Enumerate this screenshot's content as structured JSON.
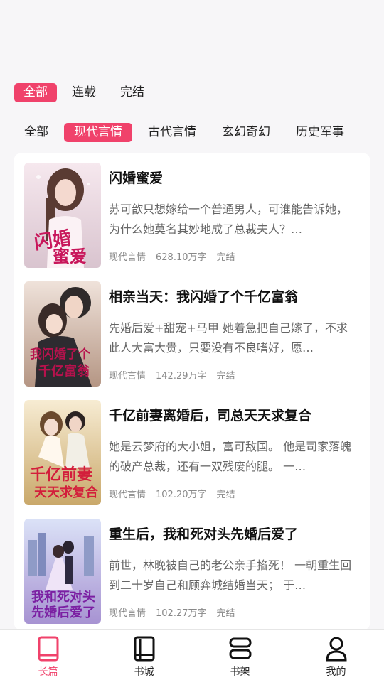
{
  "status_tabs": [
    "全部",
    "连载",
    "完结"
  ],
  "genre_tabs": [
    "全部",
    "现代言情",
    "古代言情",
    "玄幻奇幻",
    "历史军事"
  ],
  "books": [
    {
      "title": "闪婚蜜爱",
      "desc": "苏可歆只想嫁给一个普通男人，可谁能告诉她，为什么她莫名其妙地成了总裁夫人？…",
      "genre": "现代言情",
      "words": "628.10万字",
      "status": "完结"
    },
    {
      "title": "相亲当天：我闪婚了个千亿富翁",
      "desc": "先婚后爱+甜宠+马甲 她着急把自己嫁了，不求此人大富大贵，只要没有不良嗜好，愿…",
      "genre": "现代言情",
      "words": "142.29万字",
      "status": "完结"
    },
    {
      "title": "千亿前妻离婚后，司总天天求复合",
      "desc": "她是云梦府的大小姐，富可敌国。 他是司家落魄的破产总裁，还有一双残废的腿。 一…",
      "genre": "现代言情",
      "words": "102.20万字",
      "status": "完结"
    },
    {
      "title": "重生后，我和死对头先婚后爱了",
      "desc": "前世，林晚被自己的老公亲手掐死！ 一朝重生回到二十岁自己和顾弈城结婚当天； 于…",
      "genre": "现代言情",
      "words": "102.27万字",
      "status": "完结"
    }
  ],
  "covers": [
    {
      "text": "闪婚蜜爱",
      "bg1": "#f6e8ee",
      "bg2": "#d9c4cf",
      "accent": "#c8175b"
    },
    {
      "text": "我闪婚了个千亿富翁",
      "bg1": "#e9d6cd",
      "bg2": "#8a6a5c",
      "accent": "#b7124d"
    },
    {
      "text": "千亿前妻 天天求复合",
      "bg1": "#f3e7c9",
      "bg2": "#c9a86a",
      "accent": "#d31e3b"
    },
    {
      "text": "我和死对头 先婚后爱了",
      "bg1": "#cfd6f2",
      "bg2": "#9a86c7",
      "accent": "#7b1fa2"
    }
  ],
  "tabbar": [
    {
      "label": "长篇",
      "icon": "book-icon",
      "active": true
    },
    {
      "label": "书城",
      "icon": "library-icon",
      "active": false
    },
    {
      "label": "书架",
      "icon": "bookshelf-icon",
      "active": false
    },
    {
      "label": "我的",
      "icon": "user-icon",
      "active": false
    }
  ],
  "colors": {
    "accent": "#f0426b"
  }
}
